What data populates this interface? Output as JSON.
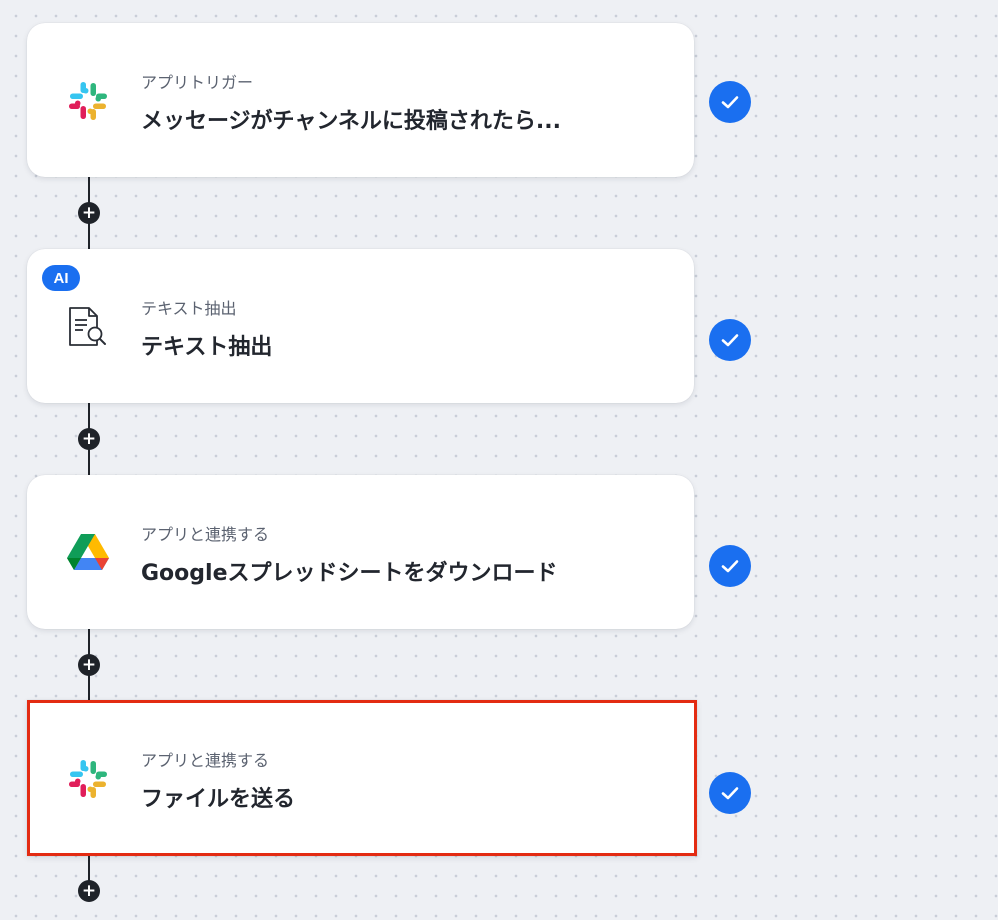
{
  "steps": [
    {
      "subtitle": "アプリトリガー",
      "title": "メッセージがチャンネルに投稿されたら...",
      "icon": "slack-icon",
      "status": "completed"
    },
    {
      "badge": "AI",
      "subtitle": "テキスト抽出",
      "title": "テキスト抽出",
      "icon": "document-search-icon",
      "status": "completed"
    },
    {
      "subtitle": "アプリと連携する",
      "title": "Googleスプレッドシートをダウンロード",
      "icon": "google-drive-icon",
      "status": "completed"
    },
    {
      "subtitle": "アプリと連携する",
      "title": "ファイルを送る",
      "icon": "slack-icon",
      "status": "completed",
      "selected": true
    }
  ],
  "colors": {
    "accent": "#1a6ff0",
    "selection_border": "#e32b12",
    "connector": "#1f2329"
  }
}
